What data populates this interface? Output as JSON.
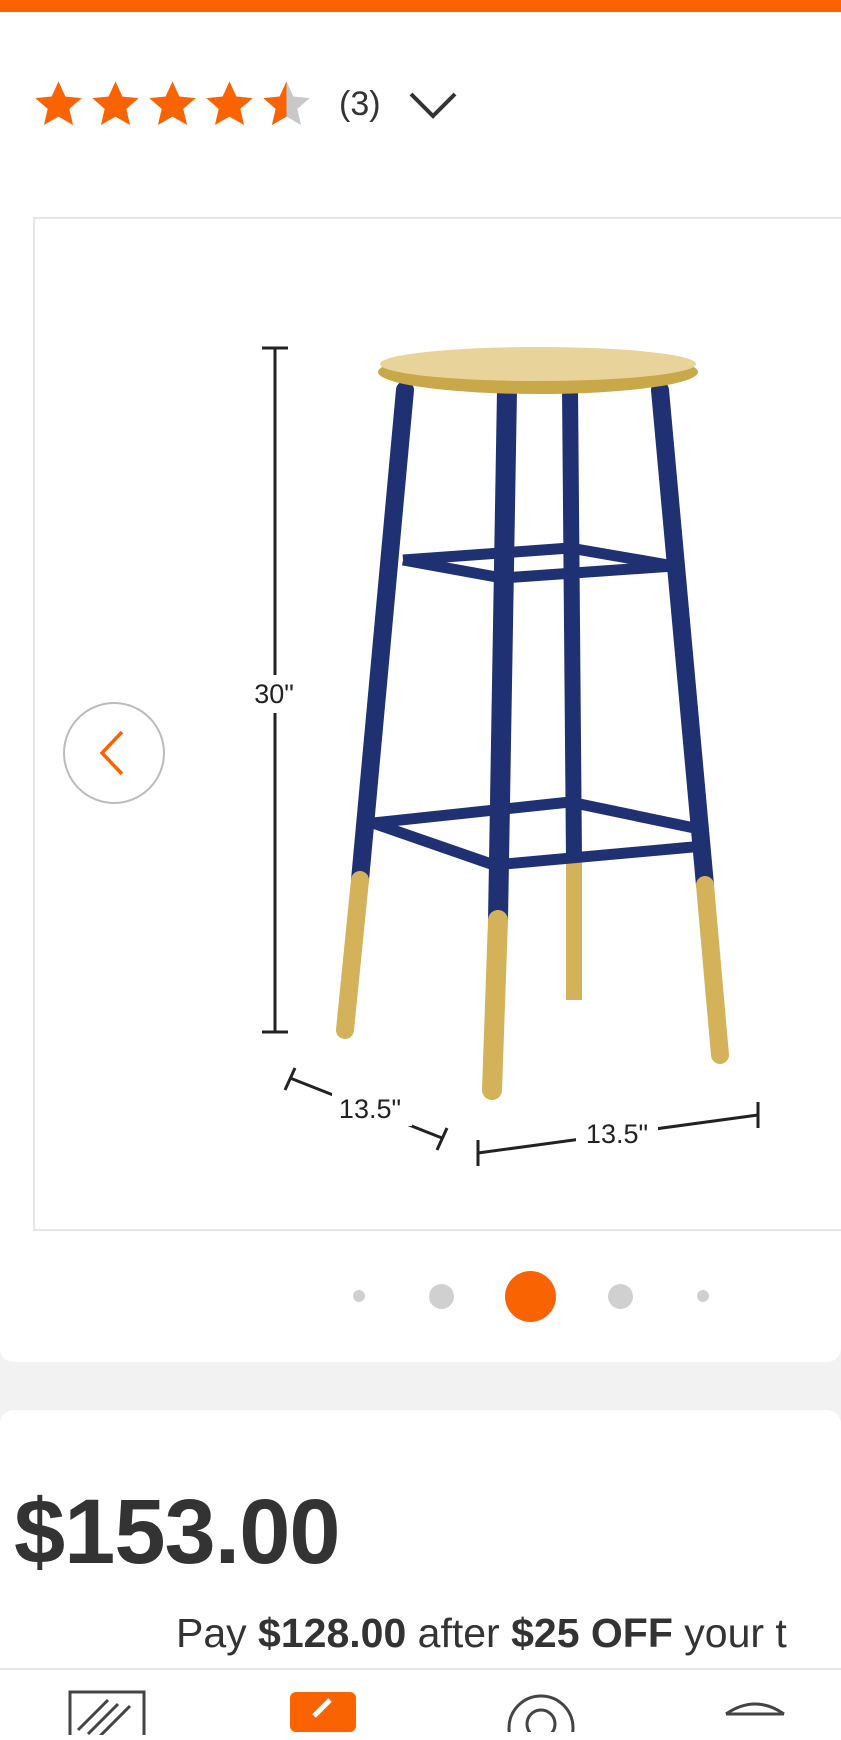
{
  "product": {
    "title": "Stool",
    "rating_value": 4.5,
    "review_count": "(3)"
  },
  "gallery": {
    "dimensions": {
      "height": "30\"",
      "depth": "13.5\"",
      "width": "13.5\""
    },
    "dots_total": 5,
    "active_dot": 3
  },
  "pricing": {
    "price": "$153.00",
    "promo_prefix": "Pay ",
    "promo_amount": "$128.00",
    "promo_mid": " after ",
    "promo_discount": "$25 OFF",
    "promo_suffix": " your t"
  },
  "nav": {
    "icons": [
      "home-depot-logo-icon",
      "shop-icon",
      "account-icon",
      "cart-icon"
    ]
  },
  "colors": {
    "accent": "#f96302",
    "navy": "#1f3172",
    "gold": "#d4b25a"
  }
}
